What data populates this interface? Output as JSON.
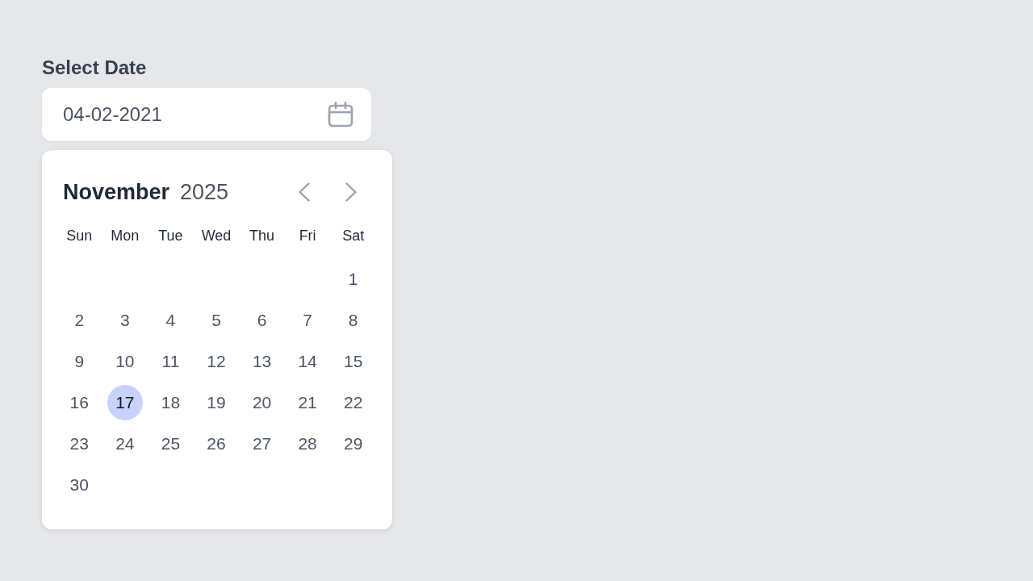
{
  "label": "Select Date",
  "date_field": {
    "value": "04-02-2021"
  },
  "calendar": {
    "month": "November",
    "year": "2025",
    "weekdays": [
      "Sun",
      "Mon",
      "Tue",
      "Wed",
      "Thu",
      "Fri",
      "Sat"
    ],
    "days": [
      {
        "kind": "blank"
      },
      {
        "kind": "blank"
      },
      {
        "kind": "blank"
      },
      {
        "kind": "blank"
      },
      {
        "kind": "blank"
      },
      {
        "kind": "blank"
      },
      {
        "kind": "day",
        "label": "1",
        "selected": false
      },
      {
        "kind": "day",
        "label": "2",
        "selected": false
      },
      {
        "kind": "day",
        "label": "3",
        "selected": false
      },
      {
        "kind": "day",
        "label": "4",
        "selected": false
      },
      {
        "kind": "day",
        "label": "5",
        "selected": false
      },
      {
        "kind": "day",
        "label": "6",
        "selected": false
      },
      {
        "kind": "day",
        "label": "7",
        "selected": false
      },
      {
        "kind": "day",
        "label": "8",
        "selected": false
      },
      {
        "kind": "day",
        "label": "9",
        "selected": false
      },
      {
        "kind": "day",
        "label": "10",
        "selected": false
      },
      {
        "kind": "day",
        "label": "11",
        "selected": false
      },
      {
        "kind": "day",
        "label": "12",
        "selected": false
      },
      {
        "kind": "day",
        "label": "13",
        "selected": false
      },
      {
        "kind": "day",
        "label": "14",
        "selected": false
      },
      {
        "kind": "day",
        "label": "15",
        "selected": false
      },
      {
        "kind": "day",
        "label": "16",
        "selected": false
      },
      {
        "kind": "day",
        "label": "17",
        "selected": true
      },
      {
        "kind": "day",
        "label": "18",
        "selected": false
      },
      {
        "kind": "day",
        "label": "19",
        "selected": false
      },
      {
        "kind": "day",
        "label": "20",
        "selected": false
      },
      {
        "kind": "day",
        "label": "21",
        "selected": false
      },
      {
        "kind": "day",
        "label": "22",
        "selected": false
      },
      {
        "kind": "day",
        "label": "23",
        "selected": false
      },
      {
        "kind": "day",
        "label": "24",
        "selected": false
      },
      {
        "kind": "day",
        "label": "25",
        "selected": false
      },
      {
        "kind": "day",
        "label": "26",
        "selected": false
      },
      {
        "kind": "day",
        "label": "27",
        "selected": false
      },
      {
        "kind": "day",
        "label": "28",
        "selected": false
      },
      {
        "kind": "day",
        "label": "29",
        "selected": false
      },
      {
        "kind": "day",
        "label": "30",
        "selected": false
      }
    ]
  }
}
